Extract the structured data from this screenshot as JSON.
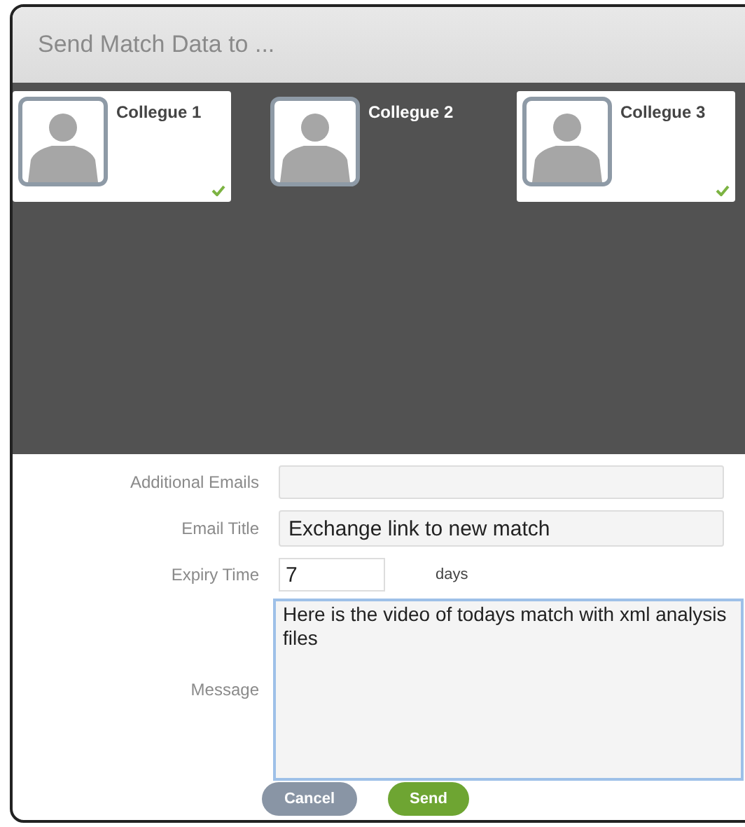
{
  "dialog": {
    "title": "Send Match Data to ..."
  },
  "colleagues": [
    {
      "name": "Collegue 1",
      "selected": true
    },
    {
      "name": "Collegue 2",
      "selected": false
    },
    {
      "name": "Collegue 3",
      "selected": true
    }
  ],
  "form": {
    "additional_emails": {
      "label": "Additional Emails"
    },
    "email_title": {
      "label": "Email Title",
      "value": "Exchange link to new match"
    },
    "expiry_time": {
      "label": "Expiry Time",
      "value": "7",
      "unit": "days"
    },
    "message": {
      "label": "Message",
      "value": "Here is the video of todays match with xml analysis files"
    }
  },
  "buttons": [
    {
      "label": "Cancel",
      "kind": "secondary"
    },
    {
      "label": "Send",
      "kind": "primary"
    }
  ]
}
